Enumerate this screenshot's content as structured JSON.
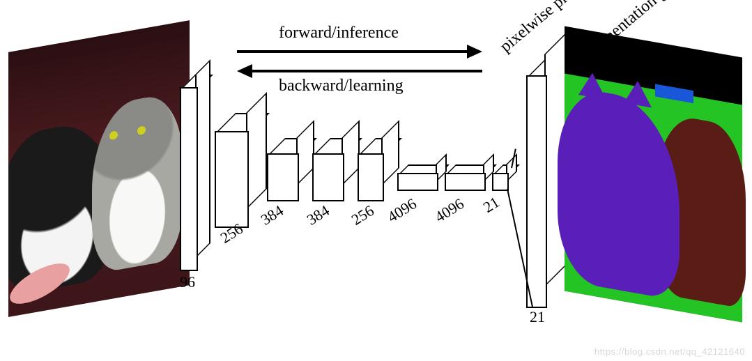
{
  "diagram": {
    "arrows": {
      "forward_label": "forward/inference",
      "backward_label": "backward/learning"
    },
    "output_labels": {
      "pixelwise": "pixelwise prediction",
      "segmentation": "segmentation g.t."
    },
    "layers": [
      {
        "idx": 0,
        "channels": "96"
      },
      {
        "idx": 1,
        "channels": "256"
      },
      {
        "idx": 2,
        "channels": "384"
      },
      {
        "idx": 3,
        "channels": "384"
      },
      {
        "idx": 4,
        "channels": "256"
      },
      {
        "idx": 5,
        "channels": "4096"
      },
      {
        "idx": 6,
        "channels": "4096"
      },
      {
        "idx": 7,
        "channels": "21"
      }
    ],
    "upsample_layer": {
      "channels": "21"
    },
    "watermark": "https://blog.csdn.net/qq_42121640"
  }
}
